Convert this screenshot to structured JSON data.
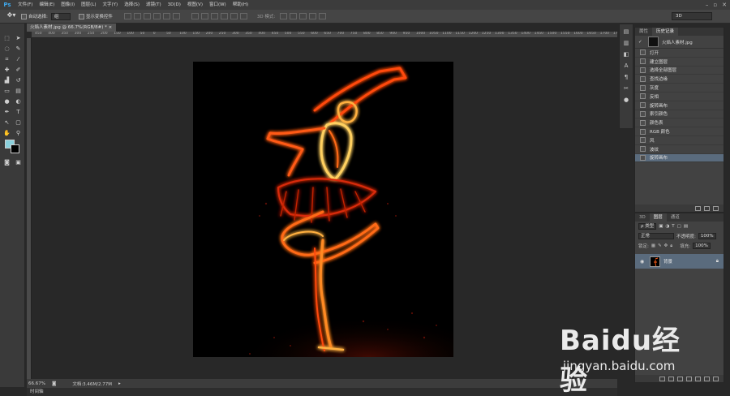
{
  "menu": {
    "logo": "Ps",
    "items": [
      "文件(F)",
      "编辑(E)",
      "图像(I)",
      "图层(L)",
      "文字(Y)",
      "选择(S)",
      "滤镜(T)",
      "3D(D)",
      "视图(V)",
      "窗口(W)",
      "帮助(H)"
    ]
  },
  "options": {
    "auto_select_label": "自动选择:",
    "auto_select_value": "组",
    "show_transform_label": "显示变换控件",
    "mode3d_label": "3D 模式:",
    "workspace": "3D"
  },
  "document": {
    "tab_title": "火焰人素材.jpg @ 66.7%(RGB/8#) *",
    "zoom": "66.67%",
    "doc_info": "文档:3.46M/2.77M",
    "ruler_ticks": [
      "450",
      "400",
      "350",
      "300",
      "250",
      "200",
      "150",
      "100",
      "50",
      "0",
      "50",
      "100",
      "150",
      "200",
      "250",
      "300",
      "350",
      "400",
      "450",
      "500",
      "550",
      "600",
      "650",
      "700",
      "750",
      "800",
      "850",
      "900",
      "950",
      "1000",
      "1050",
      "1100",
      "1150",
      "1200",
      "1250",
      "1300",
      "1350",
      "1400",
      "1450",
      "1500",
      "1550",
      "1600",
      "1650",
      "1700",
      "1750"
    ]
  },
  "timeline": {
    "label": "时间轴"
  },
  "history_panel": {
    "tabs": [
      "属性",
      "历史记录"
    ],
    "snapshot": "火焰人素材.jpg",
    "steps": [
      "打开",
      "建立图层",
      "选择全部图层",
      "查找边缘",
      "灰度",
      "反相",
      "旋转画布",
      "索引颜色",
      "颜色表",
      "RGB 颜色",
      "风",
      "波纹",
      "旋转画布"
    ],
    "selected_index": 12
  },
  "layers_panel": {
    "tabs": [
      "3D",
      "图层",
      "通道"
    ],
    "filter_label": "ρ 类型",
    "blend_mode": "正常",
    "opacity_label": "不透明度:",
    "opacity_value": "100%",
    "lock_label": "锁定:",
    "fill_label": "填充:",
    "fill_value": "100%",
    "layer_name": "背景"
  },
  "watermark": {
    "brand": "Baidu经验",
    "url": "jingyan.baidu.com"
  }
}
